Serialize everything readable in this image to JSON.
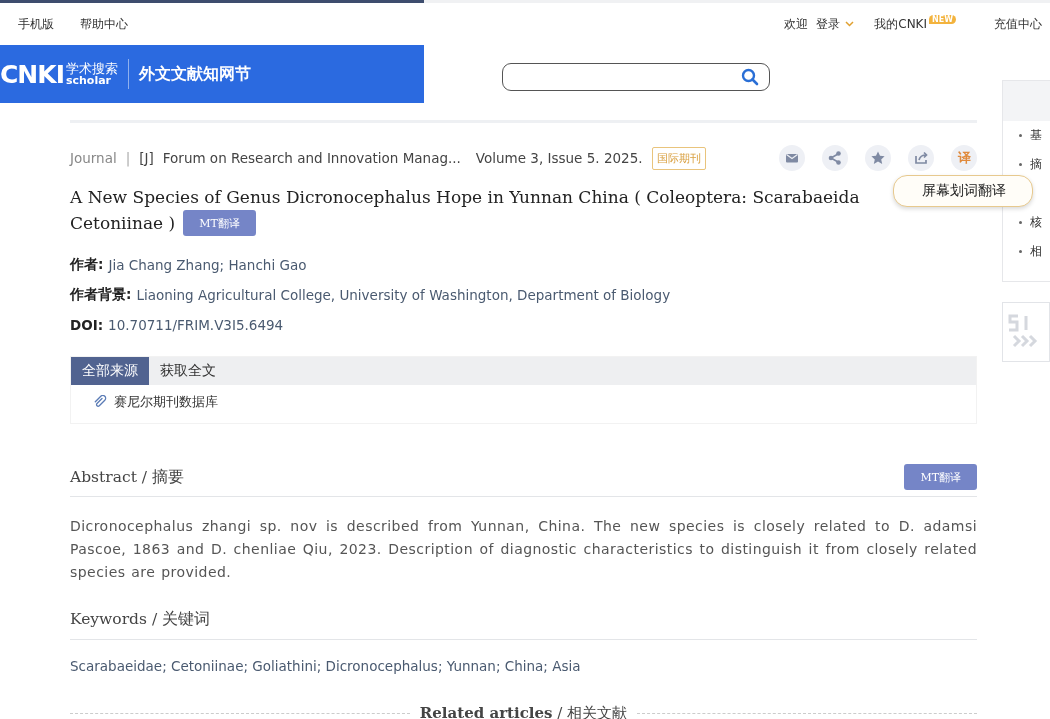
{
  "top_bar": {
    "left_links": [
      "手机版",
      "帮助中心"
    ],
    "welcome": "欢迎",
    "login": "登录",
    "my_cnki": "我的CNKI",
    "new_badge": "NEW",
    "recharge": "充值中心"
  },
  "logo": {
    "brand": "CNKI",
    "brand_cn": "学术搜索",
    "brand_en": "scholar",
    "site_name": "外文文献知网节"
  },
  "meta": {
    "type": "Journal",
    "separator": "|",
    "tag": "[J]",
    "journal": "Forum on Research and Innovation Manag...",
    "issue": "Volume 3, Issue 5. 2025.",
    "badge": "国际期刊",
    "translate_icon": "译"
  },
  "tooltip": "屏幕划词翻译",
  "title_lines": [
    "A New Species of Genus Dicronocephalus Hope in Yunnan China ( Coleoptera: Scarabaeida",
    "Cetoniinae )"
  ],
  "mt_button": "MT翻译",
  "fields": [
    {
      "label": "作者:",
      "value": "Jia Chang Zhang; Hanchi Gao"
    },
    {
      "label": "作者背景:",
      "value": "Liaoning Agricultural College, University of Washington, Department of Biology"
    },
    {
      "label": "DOI:",
      "value": "10.70711/FRIM.V3I5.6494"
    }
  ],
  "source_tabs": [
    {
      "label": "全部来源",
      "selected": true
    },
    {
      "label": "获取全文",
      "selected": false
    }
  ],
  "sources": [
    "赛尼尔期刊数据库"
  ],
  "abstract": {
    "heading": "Abstract / 摘要",
    "mt_button": "MT翻译",
    "text": "Dicronocephalus zhangi sp. nov is described from Yunnan, China. The new species is closely related to D. adamsi Pascoe, 1863 and D. chenliae Qiu, 2023. Description of diagnostic characteristics to distinguish it from closely related species are provided."
  },
  "keywords": {
    "heading": "Keywords / 关键词",
    "text": "Scarabaeidae; Cetoniinae; Goliathini; Dicronocephalus; Yunnan; China; Asia"
  },
  "related_heading": "**Related articles** / 相关文献",
  "sidebar": {
    "items": [
      "基",
      "摘",
      "核",
      "相"
    ]
  }
}
